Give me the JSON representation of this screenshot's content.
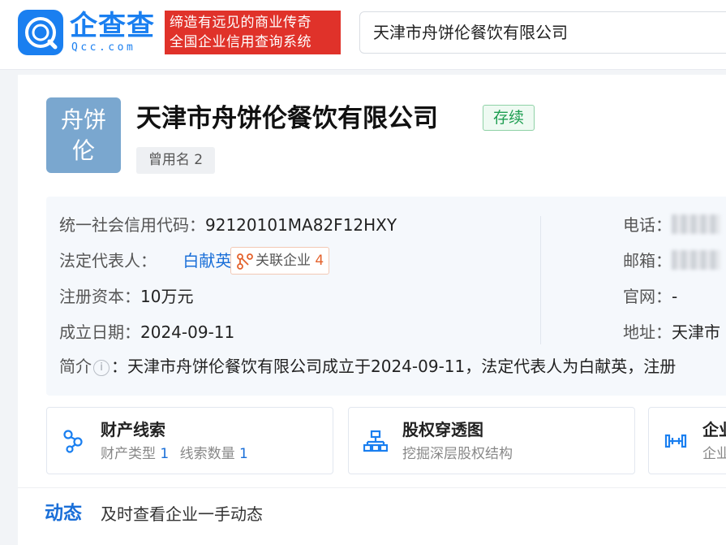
{
  "header": {
    "logo_text": "企查查",
    "logo_sub": "Qcc.com",
    "slogan_line1": "缔造有远见的商业传奇",
    "slogan_line2": "全国企业信用查询系统",
    "search_value": "天津市舟饼伦餐饮有限公司"
  },
  "company": {
    "avatar_line1": "舟饼",
    "avatar_line2": "伦",
    "name": "天津市舟饼伦餐饮有限公司",
    "status": "存续",
    "alias_label": "曾用名 2"
  },
  "info": {
    "credit_code_label": "统一社会信用代码：",
    "credit_code": "92120101MA82F12HXY",
    "legal_rep_label": "法定代表人：",
    "legal_rep": "白献英",
    "assoc_label": "关联企业",
    "assoc_count": "4",
    "capital_label": "注册资本：",
    "capital": "10万元",
    "founded_label": "成立日期：",
    "founded": "2024-09-11",
    "intro_label": "简介",
    "intro_text": "：天津市舟饼伦餐饮有限公司成立于2024-09-11，法定代表人为白献英，注册",
    "phone_label": "电话：",
    "email_label": "邮箱：",
    "website_label": "官网：",
    "website": "-",
    "address_label": "地址：",
    "address": "天津市"
  },
  "features": [
    {
      "title": "财产线索",
      "sub_a": "财产类型",
      "num_a": "1",
      "sub_b": "线索数量",
      "num_b": "1"
    },
    {
      "title": "股权穿透图",
      "sub": "挖掘深层股权结构"
    },
    {
      "title": "企业",
      "sub": "企业"
    }
  ],
  "dynamics": {
    "title": "动态",
    "subtitle": "及时查看企业一手动态"
  },
  "colors": {
    "brand_blue": "#1a7ff0",
    "slogan_red": "#e0322a",
    "status_green": "#1f9e52",
    "link_blue": "#1a6fd8",
    "avatar_bg": "#7aa7cf"
  }
}
